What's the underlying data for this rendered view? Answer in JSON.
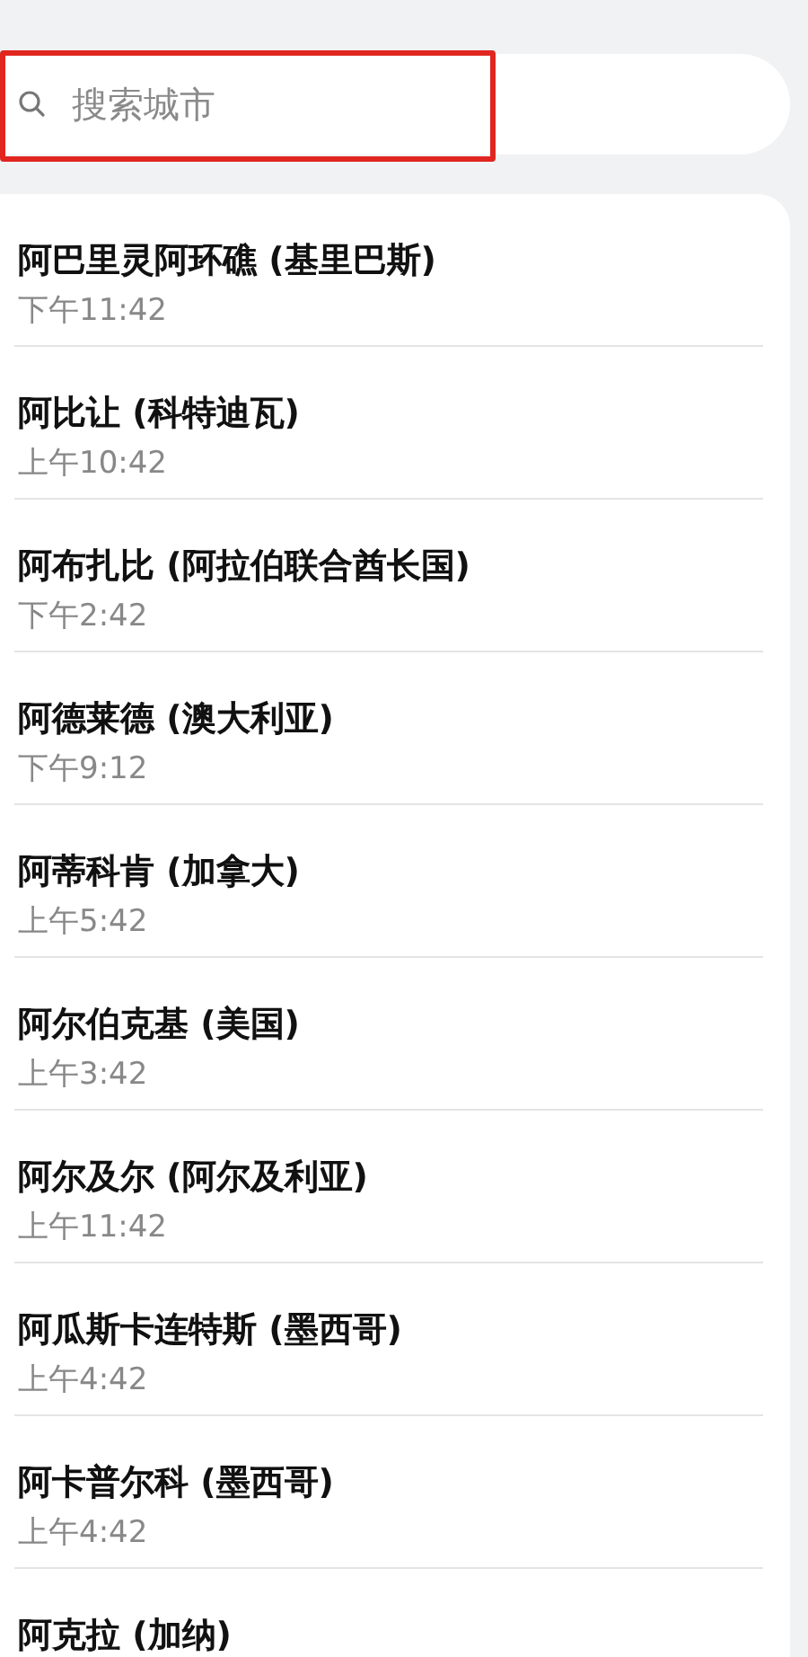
{
  "search": {
    "placeholder": "搜索城市",
    "highlighted": true
  },
  "cities": [
    {
      "name": "阿巴里灵阿环礁 (基里巴斯)",
      "time": "下午11:42"
    },
    {
      "name": "阿比让 (科特迪瓦)",
      "time": "上午10:42"
    },
    {
      "name": "阿布扎比 (阿拉伯联合酋长国)",
      "time": "下午2:42"
    },
    {
      "name": "阿德莱德 (澳大利亚)",
      "time": "下午9:12"
    },
    {
      "name": "阿蒂科肯 (加拿大)",
      "time": "上午5:42"
    },
    {
      "name": "阿尔伯克基 (美国)",
      "time": "上午3:42"
    },
    {
      "name": "阿尔及尔 (阿尔及利亚)",
      "time": "上午11:42"
    },
    {
      "name": "阿瓜斯卡连特斯 (墨西哥)",
      "time": "上午4:42"
    },
    {
      "name": "阿卡普尔科 (墨西哥)",
      "time": "上午4:42"
    },
    {
      "name": "阿克拉 (加纳)"
    }
  ]
}
